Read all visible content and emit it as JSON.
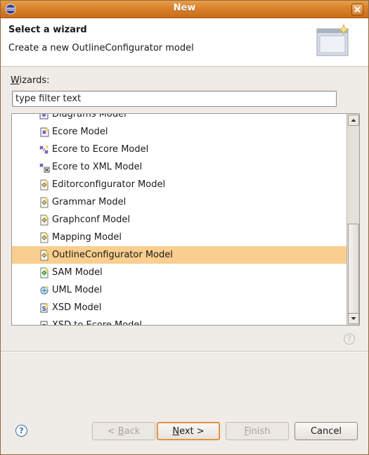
{
  "window": {
    "title": "New"
  },
  "banner": {
    "title": "Select a wizard",
    "description": "Create a new OutlineConfigurator model"
  },
  "wizards_label": {
    "prefix": "W",
    "rest": "izards:"
  },
  "filter": {
    "value": "type filter text"
  },
  "tree": {
    "items": [
      {
        "label": "Diagrams Model",
        "icon": "diagram-model-icon"
      },
      {
        "label": "Ecore Model",
        "icon": "ecore-model-icon"
      },
      {
        "label": "Ecore to Ecore Model",
        "icon": "ecore-to-ecore-icon"
      },
      {
        "label": "Ecore to XML Model",
        "icon": "ecore-to-xml-icon"
      },
      {
        "label": "Editorconfigurator Model",
        "icon": "model-file-icon"
      },
      {
        "label": "Grammar Model",
        "icon": "model-file-icon"
      },
      {
        "label": "Graphconf Model",
        "icon": "model-file-icon"
      },
      {
        "label": "Mapping Model",
        "icon": "model-file-icon"
      },
      {
        "label": "OutlineConfigurator Model",
        "icon": "model-file-icon",
        "selected": true
      },
      {
        "label": "SAM Model",
        "icon": "model-file-green-icon"
      },
      {
        "label": "UML Model",
        "icon": "uml-model-icon"
      },
      {
        "label": "XSD Model",
        "icon": "xsd-model-icon"
      },
      {
        "label": "XSD to Ecore Model",
        "icon": "xsd-to-ecore-icon"
      }
    ]
  },
  "buttons": {
    "back": {
      "u": "B",
      "rest": "ack",
      "prefix": "< "
    },
    "next": {
      "u": "N",
      "rest": "ext >"
    },
    "finish": {
      "u": "F",
      "rest": "inish"
    },
    "cancel": "Cancel"
  },
  "colors": {
    "titlebar": "#d9812b",
    "selection": "#f9ce8e",
    "dialog_bg": "#efebe7"
  }
}
